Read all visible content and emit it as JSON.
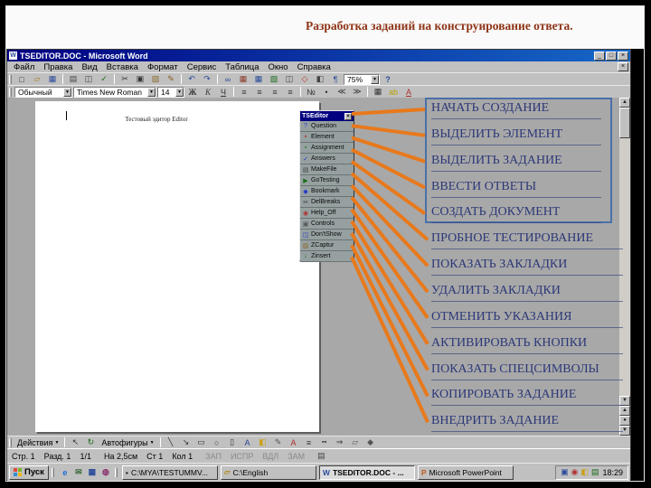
{
  "slide": {
    "title": "Разработка заданий на конструирование ответа."
  },
  "colors": {
    "orange": "#e8791c",
    "callout_text": "#2c3878",
    "box_border": "#4a70a8",
    "titlebar_left": "#000080",
    "titlebar_right": "#1668c8"
  },
  "glyphs": {
    "caret": "▼",
    "up_arrow": "▲",
    "down_arrow": "▼",
    "page_up": "▲",
    "page_down": "▼",
    "select_browse": "●"
  },
  "callouts": [
    "НАЧАТЬ СОЗДАНИЕ",
    "ВЫДЕЛИТЬ ЭЛЕМЕНТ",
    "ВЫДЕЛИТЬ ЗАДАНИЕ",
    "ВВЕСТИ ОТВЕТЫ",
    "СОЗДАТЬ ДОКУМЕНТ",
    "ПРОБНОЕ ТЕСТИРОВАНИЕ",
    "ПОКАЗАТЬ ЗАКЛАДКИ",
    "УДАЛИТЬ ЗАКЛАДКИ",
    "ОТМЕНИТЬ УКАЗАНИЯ",
    "АКТИВИРОВАТЬ КНОПКИ",
    "ПОКАЗАТЬ СПЕЦСИМВОЛЫ",
    "КОПИРОВАТЬ ЗАДАНИЕ",
    "ВНЕДРИТЬ ЗАДАНИЕ"
  ],
  "word": {
    "titlebar": {
      "icon_letter": "W",
      "title": "TSEDITOR.DOC - Microsoft Word",
      "minimize": "_",
      "maximize": "□",
      "close": "×"
    },
    "menubar": {
      "items": [
        "Файл",
        "Правка",
        "Вид",
        "Вставка",
        "Формат",
        "Сервис",
        "Таблица",
        "Окно",
        "Справка"
      ],
      "close": "×"
    },
    "standard_toolbar": {
      "icons": [
        {
          "name": "new-document-icon",
          "glyph": "□",
          "color": "#333333"
        },
        {
          "name": "open-icon",
          "glyph": "▱",
          "color": "#a87818"
        },
        {
          "name": "save-icon",
          "glyph": "▦",
          "color": "#2a4a9a"
        },
        {
          "name": "separator"
        },
        {
          "name": "print-icon",
          "glyph": "▤",
          "color": "#444444"
        },
        {
          "name": "print-preview-icon",
          "glyph": "◫",
          "color": "#444444"
        },
        {
          "name": "spelling-icon",
          "glyph": "✓",
          "color": "#1a6a1a"
        },
        {
          "name": "separator"
        },
        {
          "name": "cut-icon",
          "glyph": "✂",
          "color": "#333333"
        },
        {
          "name": "copy-icon",
          "glyph": "▣",
          "color": "#333333"
        },
        {
          "name": "paste-icon",
          "glyph": "▨",
          "color": "#8a6a2a"
        },
        {
          "name": "format-painter-icon",
          "glyph": "✎",
          "color": "#8a5a1a"
        },
        {
          "name": "separator"
        },
        {
          "name": "undo-icon",
          "glyph": "↶",
          "color": "#2a4a9a"
        },
        {
          "name": "redo-icon",
          "glyph": "↷",
          "color": "#2a4a9a"
        },
        {
          "name": "separator"
        },
        {
          "name": "insert-hyperlink-icon",
          "glyph": "∞",
          "color": "#2a4a9a"
        },
        {
          "name": "tables-borders-icon",
          "glyph": "▦",
          "color": "#8a3a2a"
        },
        {
          "name": "insert-table-icon",
          "glyph": "▦",
          "color": "#2a4a9a"
        },
        {
          "name": "insert-excel-icon",
          "glyph": "▧",
          "color": "#1a6a1a"
        },
        {
          "name": "columns-icon",
          "glyph": "◫",
          "color": "#444444"
        },
        {
          "name": "drawing-icon",
          "glyph": "◇",
          "color": "#b03a2a"
        },
        {
          "name": "document-map-icon",
          "glyph": "◧",
          "color": "#444444"
        },
        {
          "name": "show-hide-icon",
          "glyph": "¶",
          "color": "#2a4a9a"
        }
      ],
      "zoom": "75%",
      "help": "?"
    },
    "formatting_toolbar": {
      "style": "Обычный",
      "font": "Times New Roman",
      "size": "14",
      "buttons": [
        {
          "name": "bold-button",
          "glyph": "Ж",
          "cls": "b"
        },
        {
          "name": "italic-button",
          "glyph": "К",
          "cls": "i"
        },
        {
          "name": "underline-button",
          "glyph": "Ч",
          "cls": "u"
        },
        {
          "name": "separator"
        },
        {
          "name": "align-left-icon",
          "glyph": "≡"
        },
        {
          "name": "align-center-icon",
          "glyph": "≡"
        },
        {
          "name": "align-right-icon",
          "glyph": "≡"
        },
        {
          "name": "justify-icon",
          "glyph": "≡"
        },
        {
          "name": "separator"
        },
        {
          "name": "numbered-list-icon",
          "glyph": "№"
        },
        {
          "name": "bullet-list-icon",
          "glyph": "•"
        },
        {
          "name": "decrease-indent-icon",
          "glyph": "≪"
        },
        {
          "name": "increase-indent-icon",
          "glyph": "≫"
        },
        {
          "name": "separator"
        },
        {
          "name": "borders-icon",
          "glyph": "▦"
        },
        {
          "name": "highlight-icon",
          "glyph": "ab",
          "color": "#b8a000"
        },
        {
          "name": "font-color-icon",
          "glyph": "А",
          "color": "#b03030",
          "cls": "u"
        }
      ]
    },
    "document_text": "Тестовый эдитор Editor",
    "drawing_toolbar": {
      "actions_label": "Действия",
      "autoshapes_label": "Автофигуры",
      "icons_left": [
        {
          "name": "select-objects-icon",
          "glyph": "↖",
          "color": "#333333"
        },
        {
          "name": "free-rotate-icon",
          "glyph": "↻",
          "color": "#1a6a1a"
        }
      ],
      "icons_right": [
        {
          "name": "line-icon",
          "glyph": "╲",
          "color": "#333333"
        },
        {
          "name": "arrow-icon",
          "glyph": "↘",
          "color": "#333333"
        },
        {
          "name": "rectangle-icon",
          "glyph": "▭",
          "color": "#333333"
        },
        {
          "name": "oval-icon",
          "glyph": "○",
          "color": "#333333"
        },
        {
          "name": "text-box-icon",
          "glyph": "▯",
          "color": "#333333"
        },
        {
          "name": "wordart-icon",
          "glyph": "A",
          "color": "#2a4a9a"
        },
        {
          "name": "fill-color-icon",
          "glyph": "◧",
          "color": "#caa018"
        },
        {
          "name": "line-color-icon",
          "glyph": "✎",
          "color": "#555555"
        },
        {
          "name": "font-color-2-icon",
          "glyph": "А",
          "color": "#b03030"
        },
        {
          "name": "line-style-icon",
          "glyph": "≡",
          "color": "#333333"
        },
        {
          "name": "dash-style-icon",
          "glyph": "╍",
          "color": "#333333"
        },
        {
          "name": "arrow-style-icon",
          "glyph": "⇒",
          "color": "#333333"
        },
        {
          "name": "shadow-icon",
          "glyph": "▱",
          "color": "#555555"
        },
        {
          "name": "3d-icon",
          "glyph": "◆",
          "color": "#555555"
        }
      ]
    },
    "status_bar": {
      "left": [
        "Стр. 1",
        "Разд. 1",
        "1/1"
      ],
      "middle": [
        "На 2,5см",
        "Ст 1",
        "Кол 1"
      ],
      "toggles": [
        "ЗАП",
        "ИСПР",
        "ВДЛ",
        "ЗАМ"
      ],
      "book_icon": "▤"
    }
  },
  "tseditor": {
    "title": "TSEditor",
    "close": "×",
    "buttons": [
      {
        "name": "question-button",
        "icon": "?",
        "icon_color": "#2a3ac8",
        "label": "Question"
      },
      {
        "name": "element-button",
        "icon": "▪",
        "icon_color": "#b03030",
        "label": "Element"
      },
      {
        "name": "assignment-button",
        "icon": "▪",
        "icon_color": "#2a8a2a",
        "label": "Assignment"
      },
      {
        "name": "answers-button",
        "icon": "✓",
        "icon_color": "#2a3ac8",
        "label": "Answers"
      },
      {
        "name": "makefile-button",
        "icon": "▤",
        "icon_color": "#444444",
        "label": "MakeFile"
      },
      {
        "name": "gotesting-button",
        "icon": "▶",
        "icon_color": "#1a6a1a",
        "label": "GoTesting"
      },
      {
        "name": "bookmark-button",
        "icon": "◆",
        "icon_color": "#2a3ac8",
        "label": "Bookmark"
      },
      {
        "name": "delbreaks-button",
        "icon": "✂",
        "icon_color": "#333333",
        "label": "DelBreaks"
      },
      {
        "name": "helpoff-button",
        "icon": "◉",
        "icon_color": "#b03030",
        "label": "Help_Off"
      },
      {
        "name": "controls-button",
        "icon": "▣",
        "icon_color": "#555555",
        "label": "Controls"
      },
      {
        "name": "dontshow-button",
        "icon": "◫",
        "icon_color": "#2a3ac8",
        "label": "Don'tShow"
      },
      {
        "name": "zcaptur-button",
        "icon": "▨",
        "icon_color": "#8a6a2a",
        "label": "ZCaptur"
      },
      {
        "name": "zinsert-button",
        "icon": "↓",
        "icon_color": "#1a6a1a",
        "label": "Zinsert"
      }
    ]
  },
  "taskbar": {
    "start_label": "Пуск",
    "start_logo_colors": [
      "#e4483b",
      "#7bb42c",
      "#2e8fd8",
      "#f2b713"
    ],
    "quick_launch": [
      {
        "name": "ie-icon",
        "glyph": "e",
        "color": "#1a6ad4"
      },
      {
        "name": "outlook-icon",
        "glyph": "✉",
        "color": "#3a6a3a"
      },
      {
        "name": "show-desktop-icon",
        "glyph": "▦",
        "color": "#2a4a9a"
      },
      {
        "name": "channels-icon",
        "glyph": "◍",
        "color": "#8a2a6a"
      }
    ],
    "windows": [
      {
        "name": "task-ms-dos",
        "icon": "▪",
        "icon_color": "#222222",
        "label": "C:\\MYA\\TESTUMMV...",
        "active": false
      },
      {
        "name": "task-explorer",
        "icon": "▱",
        "icon_color": "#b08a18",
        "label": "C:\\English",
        "active": false
      },
      {
        "name": "task-word",
        "icon": "W",
        "icon_color": "#2a4a9a",
        "label": "TSEDITOR.DOC - ...",
        "active": true
      },
      {
        "name": "task-powerpoint",
        "icon": "P",
        "icon_color": "#c05a1a",
        "label": "Microsoft PowerPoint",
        "active": false
      }
    ],
    "tray_icons": [
      {
        "name": "tray-icon-1",
        "glyph": "▣",
        "color": "#2a4a9a"
      },
      {
        "name": "tray-icon-2",
        "glyph": "◉",
        "color": "#b03030"
      },
      {
        "name": "tray-icon-3",
        "glyph": "◧",
        "color": "#caa018"
      },
      {
        "name": "tray-icon-4",
        "glyph": "▤",
        "color": "#1a6a1a"
      }
    ],
    "time": "18:29"
  }
}
